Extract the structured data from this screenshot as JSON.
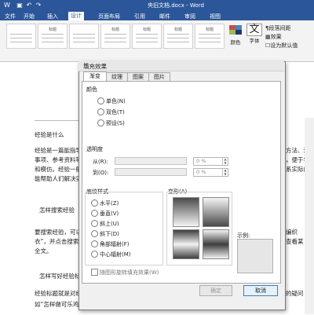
{
  "window": {
    "title": "央旧文档.docx - Word"
  },
  "quick_access": {
    "undo": "↶",
    "redo": "↷"
  },
  "ribbon_tabs": [
    "文件",
    "开始",
    "插入",
    "设计",
    "页面布局",
    "引用",
    "邮件",
    "审阅",
    "视图"
  ],
  "ribbon": {
    "style_labels": [
      "",
      "标题",
      "",
      "标题",
      "标题",
      "标题",
      "标题"
    ],
    "colors_label": "颜色",
    "fonts_label": "字体",
    "fonts_glyph": "文",
    "paragraph_spacing": "段落间距",
    "effects": "效果",
    "set_default": "设为默认值"
  },
  "document": {
    "lines": [
      "经验是什么",
      "经验是一篇能指导",
      "事项、参考资料等",
      "和模仿。经验一般",
      "能帮助人们解决实",
      "怎样搜索经验",
      "要搜索经验，可以",
      "衣”，并点击搜索",
      "全文。",
      "怎样写好经验标题",
      "经验标题就是对经",
      "如“怎样做可乐鸡翅”“怎样用做手工”"
    ],
    "right_lines": [
      "方法、注",
      "，便于学",
      "系实际的",
      "编织",
      "查看某",
      "的疑问"
    ]
  },
  "dialog": {
    "title": "填充效果",
    "close_icon": "✕",
    "tabs": [
      "渐变",
      "纹理",
      "图案",
      "图片"
    ],
    "colors_group": "颜色",
    "color_options": [
      "单色(N)",
      "双色(T)",
      "预设(S)"
    ],
    "transparency_group": "透明度",
    "from_label": "从(R):",
    "to_label": "到(O):",
    "from_value": "0 %",
    "to_value": "0 %",
    "shading_group": "底纹样式",
    "shading_options": [
      "水平(Z)",
      "垂直(V)",
      "斜上(U)",
      "斜下(D)",
      "角部辐射(F)",
      "中心辐射(M)"
    ],
    "variants_group": "变形(A)",
    "sample_label": "示例:",
    "rotate_checkbox": "随图形旋转填充效果(W)",
    "ok_label": "确定",
    "cancel_label": "取消"
  }
}
